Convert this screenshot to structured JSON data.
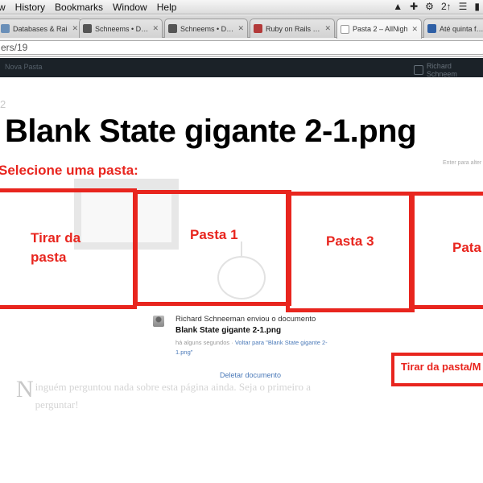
{
  "menubar": {
    "items": [
      "w",
      "History",
      "Bookmarks",
      "Window",
      "Help"
    ],
    "status_icons": [
      "bell-icon",
      "cross-icon",
      "wifi-icon",
      "battery-icon",
      "2",
      "volume-icon"
    ],
    "badge_text": "2↑"
  },
  "tabs": [
    {
      "title": "Databases & Rai",
      "favicon_color": "#6a8fb8",
      "active": false
    },
    {
      "title": "Schneems • Data",
      "favicon_color": "#555555",
      "active": false
    },
    {
      "title": "Schneems • Data",
      "favicon_color": "#555555",
      "active": false
    },
    {
      "title": "Ruby on Rails – A",
      "favicon_color": "#b33a3a",
      "active": false
    },
    {
      "title": "Pasta 2 – AllNigh",
      "favicon_color": "#e8e8e8",
      "active": true
    },
    {
      "title": "Até quinta feir",
      "favicon_color": "#2e5fa5",
      "active": false
    }
  ],
  "address": {
    "url": "ers/19"
  },
  "app_header": {
    "left_label": "Nova Pasta",
    "right_label": "Richard Schneem"
  },
  "page": {
    "page_number": "2",
    "big_title": "Blank State gigante 2-1.png",
    "select_label": "Selecione uma pasta:",
    "right_hint": "Enter para alter"
  },
  "folders": [
    {
      "label": "Tirar da pasta"
    },
    {
      "label": "Pasta 1"
    },
    {
      "label": "Pasta 3"
    },
    {
      "label": "Pata"
    }
  ],
  "activity": {
    "actor_line": "Richard Schneeman enviou o documento",
    "document": "Blank State gigante 2-1.png",
    "time": "há alguns segundos",
    "separator": "·",
    "back_link": "Voltar para \"Blank State gigante 2-1.png\"",
    "delete_link": "Deletar documento"
  },
  "corner_label": "Tirar da pasta/M",
  "background_text": {
    "dropcap": "N",
    "rest": "inguém perguntou nada sobre esta página ainda. Seja o primeiro a perguntar!"
  },
  "colors": {
    "accent_red": "#e8251e",
    "link_blue": "#4a79b8"
  }
}
